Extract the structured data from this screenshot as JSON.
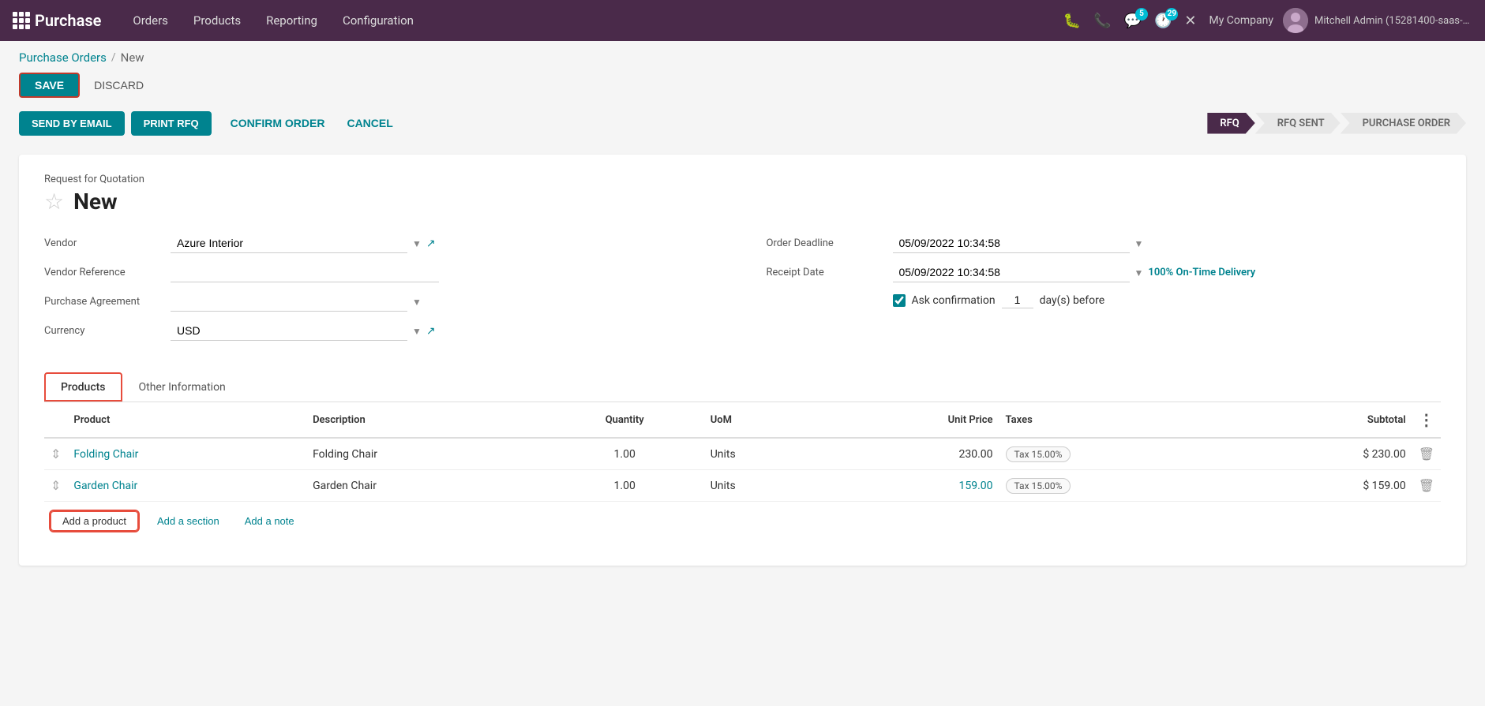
{
  "topnav": {
    "brand": "Purchase",
    "menu_items": [
      "Orders",
      "Products",
      "Reporting",
      "Configuration"
    ],
    "badge_messages": "5",
    "badge_clock": "29",
    "company": "My Company",
    "user": "Mitchell Admin (15281400-saas-15-1-a..."
  },
  "breadcrumb": {
    "parent": "Purchase Orders",
    "separator": "/",
    "current": "New"
  },
  "actions": {
    "save_label": "SAVE",
    "discard_label": "DISCARD"
  },
  "workflow": {
    "email_label": "SEND BY EMAIL",
    "print_label": "PRINT RFQ",
    "confirm_label": "CONFIRM ORDER",
    "cancel_label": "CANCEL",
    "steps": [
      {
        "label": "RFQ",
        "active": true
      },
      {
        "label": "RFQ SENT",
        "active": false
      },
      {
        "label": "PURCHASE ORDER",
        "active": false
      }
    ]
  },
  "form": {
    "rfq_subtitle": "Request for Quotation",
    "title": "New",
    "vendor_label": "Vendor",
    "vendor_value": "Azure Interior",
    "vendor_ref_label": "Vendor Reference",
    "vendor_ref_value": "",
    "purchase_agreement_label": "Purchase Agreement",
    "purchase_agreement_value": "",
    "currency_label": "Currency",
    "currency_value": "USD",
    "order_deadline_label": "Order Deadline",
    "order_deadline_value": "05/09/2022 10:34:58",
    "receipt_date_label": "Receipt Date",
    "receipt_date_value": "05/09/2022 10:34:58",
    "on_time_label": "100% On-Time Delivery",
    "ask_confirmation_label": "Ask confirmation",
    "ask_confirmation_days": "1",
    "days_before_label": "day(s) before"
  },
  "tabs": {
    "products_label": "Products",
    "other_info_label": "Other Information"
  },
  "table": {
    "headers": [
      "Product",
      "Description",
      "Quantity",
      "UoM",
      "Unit Price",
      "Taxes",
      "Subtotal"
    ],
    "rows": [
      {
        "product": "Folding Chair",
        "description": "Folding Chair",
        "quantity": "1.00",
        "uom": "Units",
        "unit_price": "230.00",
        "taxes": "Tax 15.00%",
        "subtotal": "$ 230.00"
      },
      {
        "product": "Garden Chair",
        "description": "Garden Chair",
        "quantity": "1.00",
        "uom": "Units",
        "unit_price": "159.00",
        "taxes": "Tax 15.00%",
        "subtotal": "$ 159.00"
      }
    ],
    "add_product_label": "Add a product",
    "add_section_label": "Add a section",
    "add_note_label": "Add a note"
  }
}
